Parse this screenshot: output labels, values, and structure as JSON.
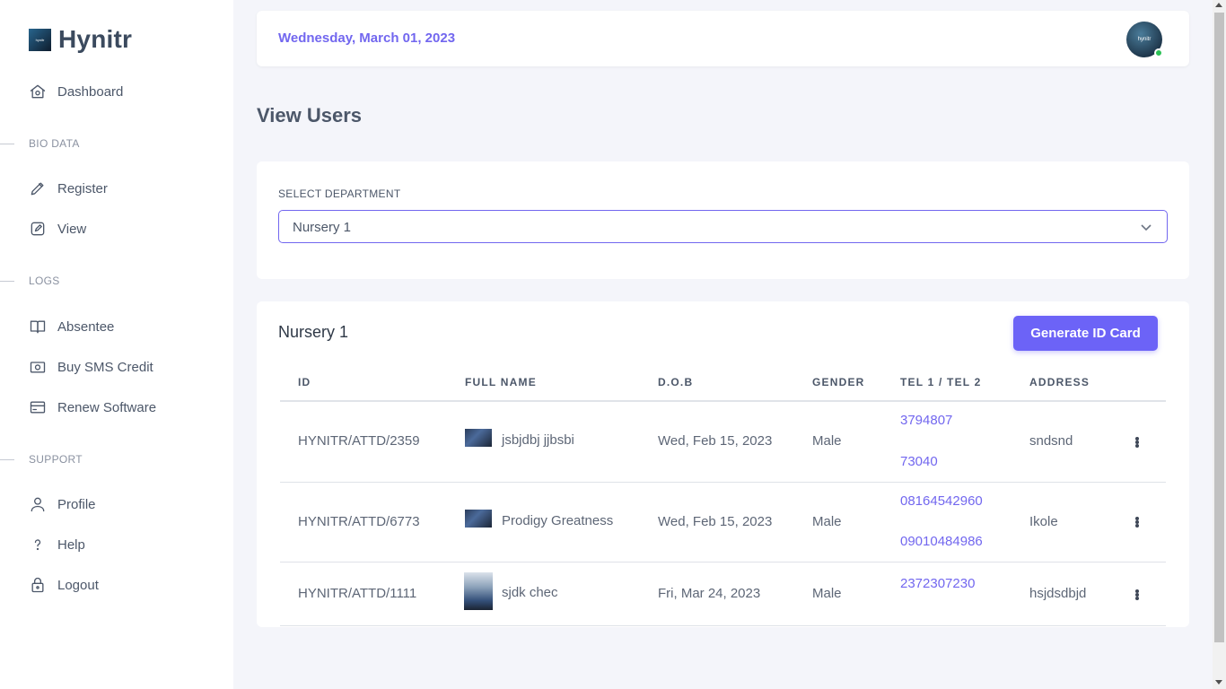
{
  "brand": {
    "name": "Hynitr",
    "logo_text": "hynitr"
  },
  "sidebar": {
    "dashboard": "Dashboard",
    "sections": {
      "bio": "BIO DATA",
      "logs": "LOGS",
      "support": "SUPPORT"
    },
    "items": {
      "register": "Register",
      "view": "View",
      "absentee": "Absentee",
      "sms": "Buy SMS Credit",
      "renew": "Renew Software",
      "profile": "Profile",
      "help": "Help",
      "logout": "Logout"
    }
  },
  "header": {
    "date": "Wednesday, March 01, 2023",
    "avatar_text": "hynitr",
    "status_color": "#2bc155"
  },
  "page": {
    "title": "View Users"
  },
  "department": {
    "label": "SELECT DEPARTMENT",
    "selected": "Nursery 1"
  },
  "table": {
    "title": "Nursery 1",
    "generate_button": "Generate ID Card",
    "columns": [
      "ID",
      "FULL NAME",
      "D.O.B",
      "GENDER",
      "TEL 1 / TEL 2",
      "ADDRESS"
    ],
    "rows": [
      {
        "id": "HYNITR/ATTD/2359",
        "name": "jsbjdbj jjbsbi",
        "dob": "Wed, Feb 15, 2023",
        "gender": "Male",
        "tel1": "3794807",
        "tel2": "73040",
        "address": "sndsnd"
      },
      {
        "id": "HYNITR/ATTD/6773",
        "name": "Prodigy Greatness",
        "dob": "Wed, Feb 15, 2023",
        "gender": "Male",
        "tel1": "08164542960",
        "tel2": "09010484986",
        "address": "Ikole"
      },
      {
        "id": "HYNITR/ATTD/1111",
        "name": "sjdk chec",
        "dob": "Fri, Mar 24, 2023",
        "gender": "Male",
        "tel1": "2372307230",
        "tel2": "",
        "address": "hsjdsdbjd"
      }
    ]
  },
  "colors": {
    "accent": "#7267ef",
    "button": "#6c63f7"
  }
}
